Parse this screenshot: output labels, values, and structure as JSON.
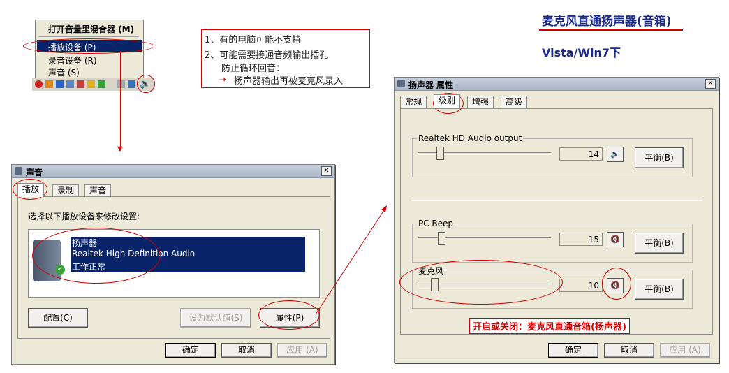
{
  "title": {
    "line1": "麦克风直通扬声器(音箱)",
    "line2": "Vista/Win7下"
  },
  "notes": {
    "line1": "1、有的电脑可能不支持",
    "line2": "2、可能需要接通音频输出插孔",
    "line3": "防止循环回音：",
    "line4": "扬声器输出再被麦克风录入"
  },
  "context_menu": {
    "items": [
      "打开音量里混合器 (M)",
      "播放设备 (P)",
      "录音设备 (R)",
      "声音 (S)"
    ]
  },
  "sound_dialog": {
    "title": "声音",
    "tabs": [
      "播放",
      "录制",
      "声音"
    ],
    "instruction": "选择以下播放设备来修改设置:",
    "device": {
      "name": "扬声器",
      "driver": "Realtek High Definition Audio",
      "status": "工作正常"
    },
    "buttons": {
      "configure": "配置(C)",
      "set_default": "设为默认值(S)",
      "properties": "属性(P)",
      "ok": "确定",
      "cancel": "取消",
      "apply": "应用 (A)"
    }
  },
  "props_dialog": {
    "title": "扬声器 属性",
    "tabs": [
      "常规",
      "级别",
      "增强",
      "高级"
    ],
    "channels": [
      {
        "label": "Realtek HD Audio output",
        "value": "14",
        "level": 14,
        "muted": false,
        "balance": "平衡(B)"
      },
      {
        "label": "PC Beep",
        "value": "15",
        "level": 15,
        "muted": true,
        "balance": "平衡(B)"
      },
      {
        "label": "麦克风",
        "value": "10",
        "level": 10,
        "muted": true,
        "balance": "平衡(B)"
      }
    ],
    "note": "开启或关闭：麦克风直通音箱(扬声器)",
    "buttons": {
      "ok": "确定",
      "cancel": "取消",
      "apply": "应用 (A)"
    }
  },
  "colors": {
    "title_blue": "#1a2a8a",
    "annotation_red": "#d30000",
    "selection": "#0a246a"
  }
}
